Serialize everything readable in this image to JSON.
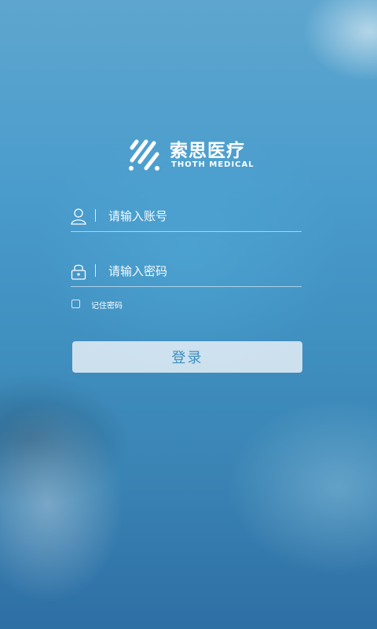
{
  "brand": {
    "name_cn": "索思医疗",
    "name_en": "THOTH MEDICAL",
    "logo_icon": "thoth-logo-icon"
  },
  "login_form": {
    "account": {
      "icon": "user-icon",
      "placeholder": "请输入账号",
      "value": ""
    },
    "password": {
      "icon": "lock-icon",
      "placeholder": "请输入密码",
      "value": ""
    },
    "remember": {
      "label": "记住密码",
      "checked": false
    },
    "submit_label": "登录"
  },
  "colors": {
    "background_top": "#5ea6cf",
    "background_bottom": "#2e6fa4",
    "button_background": "#e1ecf4",
    "button_text": "#3a8fc0"
  }
}
